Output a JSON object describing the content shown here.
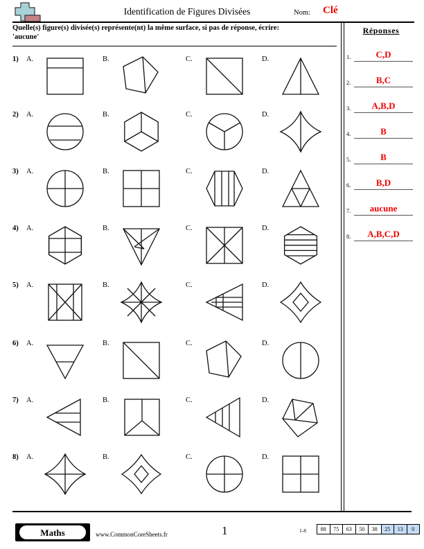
{
  "header": {
    "title": "Identification de Figures Divisées",
    "name_label": "Nom:",
    "name_value": "Clé",
    "logo_icon": "plus-block-logo",
    "accent_color": "#ee0000"
  },
  "instructions": {
    "line1": "Quelle(s) figure(s) divisée(s) représente(nt) la même surface, si pas de réponse, écrire:",
    "line2": "'aucune'"
  },
  "answers": {
    "title": "Réponses",
    "items": [
      {
        "num": "1.",
        "value": "C,D"
      },
      {
        "num": "2.",
        "value": "B,C"
      },
      {
        "num": "3.",
        "value": "A,B,D"
      },
      {
        "num": "4.",
        "value": "B"
      },
      {
        "num": "5.",
        "value": "B"
      },
      {
        "num": "6.",
        "value": "B,D"
      },
      {
        "num": "7.",
        "value": "aucune"
      },
      {
        "num": "8.",
        "value": "A,B,C,D"
      }
    ]
  },
  "problems": [
    {
      "num": "1)",
      "choices": [
        {
          "letter": "A.",
          "figure": "square-one-horizontal-line"
        },
        {
          "letter": "B.",
          "figure": "pentagon-vertical-chord"
        },
        {
          "letter": "C.",
          "figure": "square-diagonal"
        },
        {
          "letter": "D.",
          "figure": "triangle-vertical-line"
        }
      ]
    },
    {
      "num": "2)",
      "choices": [
        {
          "letter": "A.",
          "figure": "circle-two-horizontal-lines"
        },
        {
          "letter": "B.",
          "figure": "hexagon-three-rhombi"
        },
        {
          "letter": "C.",
          "figure": "circle-three-sectors"
        },
        {
          "letter": "D.",
          "figure": "star4-vertical-line"
        }
      ]
    },
    {
      "num": "3)",
      "choices": [
        {
          "letter": "A.",
          "figure": "circle-quarters"
        },
        {
          "letter": "B.",
          "figure": "square-quarters"
        },
        {
          "letter": "C.",
          "figure": "hexagon-three-vertical-lines"
        },
        {
          "letter": "D.",
          "figure": "triangle-four-triangles"
        }
      ]
    },
    {
      "num": "4)",
      "choices": [
        {
          "letter": "A.",
          "figure": "hexagon-six-parts-grid"
        },
        {
          "letter": "B.",
          "figure": "inverted-triangle-six-parts"
        },
        {
          "letter": "C.",
          "figure": "square-x-plus-vertical"
        },
        {
          "letter": "D.",
          "figure": "hexagon-five-horizontal-strips"
        }
      ]
    },
    {
      "num": "5)",
      "choices": [
        {
          "letter": "A.",
          "figure": "square-x-two-verticals"
        },
        {
          "letter": "B.",
          "figure": "star4-eight-parts"
        },
        {
          "letter": "C.",
          "figure": "left-triangle-grid"
        },
        {
          "letter": "D.",
          "figure": "star4-center-diamond"
        }
      ]
    },
    {
      "num": "6)",
      "choices": [
        {
          "letter": "A.",
          "figure": "inverted-triangle-horizontal-line"
        },
        {
          "letter": "B.",
          "figure": "square-diagonal-halves"
        },
        {
          "letter": "C.",
          "figure": "pentagon-vertical-chord"
        },
        {
          "letter": "D.",
          "figure": "circle-vertical-halves"
        }
      ]
    },
    {
      "num": "7)",
      "choices": [
        {
          "letter": "A.",
          "figure": "left-triangle-two-horizontals"
        },
        {
          "letter": "B.",
          "figure": "square-y-division"
        },
        {
          "letter": "C.",
          "figure": "left-triangle-two-verticals"
        },
        {
          "letter": "D.",
          "figure": "pentagon-three-parts"
        }
      ]
    },
    {
      "num": "8)",
      "choices": [
        {
          "letter": "A.",
          "figure": "star4-cross-quarters"
        },
        {
          "letter": "B.",
          "figure": "star4-diamond-center"
        },
        {
          "letter": "C.",
          "figure": "circle-cross-quarters"
        },
        {
          "letter": "D.",
          "figure": "square-cross-quarters"
        }
      ]
    }
  ],
  "footer": {
    "badge_label": "Maths",
    "site_url": "www.CommonCoreSheets.fr",
    "page_number": "1",
    "score_range": "1-8",
    "score_boxes": [
      {
        "value": "88",
        "highlighted": false
      },
      {
        "value": "75",
        "highlighted": false
      },
      {
        "value": "63",
        "highlighted": false
      },
      {
        "value": "50",
        "highlighted": false
      },
      {
        "value": "38",
        "highlighted": false
      },
      {
        "value": "25",
        "highlighted": true
      },
      {
        "value": "13",
        "highlighted": true
      },
      {
        "value": "0",
        "highlighted": true
      }
    ],
    "highlight_color": "#c5dcf5"
  }
}
